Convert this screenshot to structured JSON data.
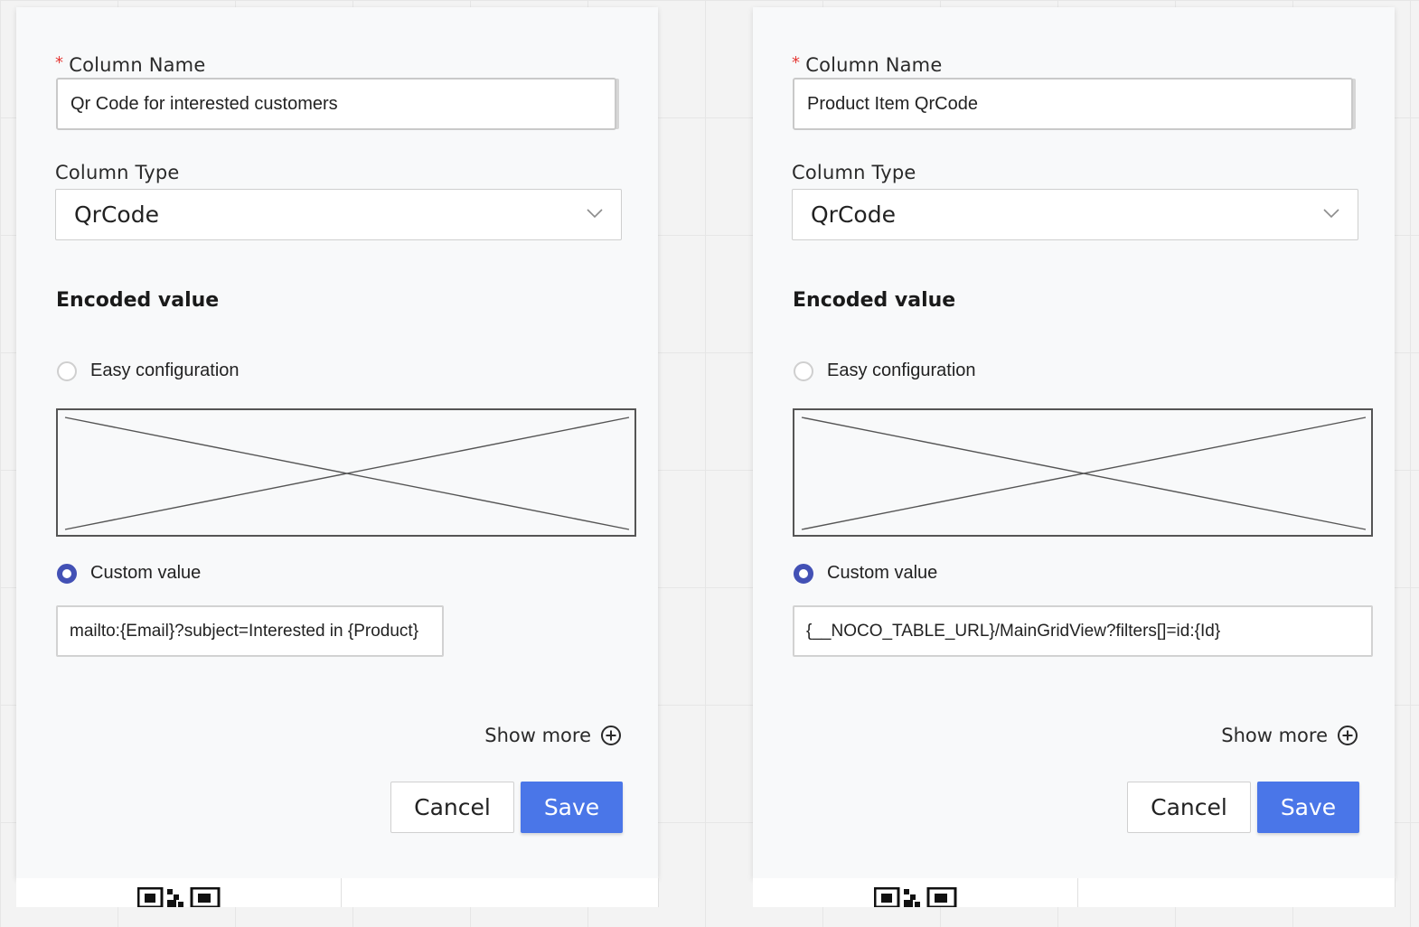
{
  "panels": [
    {
      "column_name_label": "Column Name",
      "required_marker": "*",
      "column_name_value": "Qr Code for interested customers",
      "column_type_label": "Column Type",
      "column_type_value": "QrCode",
      "section_title": "Encoded value",
      "easy_config_label": "Easy configuration",
      "custom_value_label": "Custom value",
      "custom_value": "mailto:{Email}?subject=Interested in {Product}",
      "show_more_label": "Show more",
      "cancel_label": "Cancel",
      "save_label": "Save",
      "selected_option": "Custom value"
    },
    {
      "column_name_label": "Column Name",
      "required_marker": "*",
      "column_name_value": "Product Item QrCode",
      "column_type_label": "Column Type",
      "column_type_value": "QrCode",
      "section_title": "Encoded value",
      "easy_config_label": "Easy configuration",
      "custom_value_label": "Custom value",
      "custom_value": "{__NOCO_TABLE_URL}/MainGridView?filters[]=id:{Id}",
      "show_more_label": "Show more",
      "cancel_label": "Cancel",
      "save_label": "Save",
      "selected_option": "Custom value"
    }
  ],
  "colors": {
    "accent_radio": "#4351b5",
    "save_button": "#4a76e8",
    "required_star": "#e53935"
  },
  "icons": [
    "chevron-down-icon",
    "plus-circle-icon",
    "qr-code-icon"
  ]
}
